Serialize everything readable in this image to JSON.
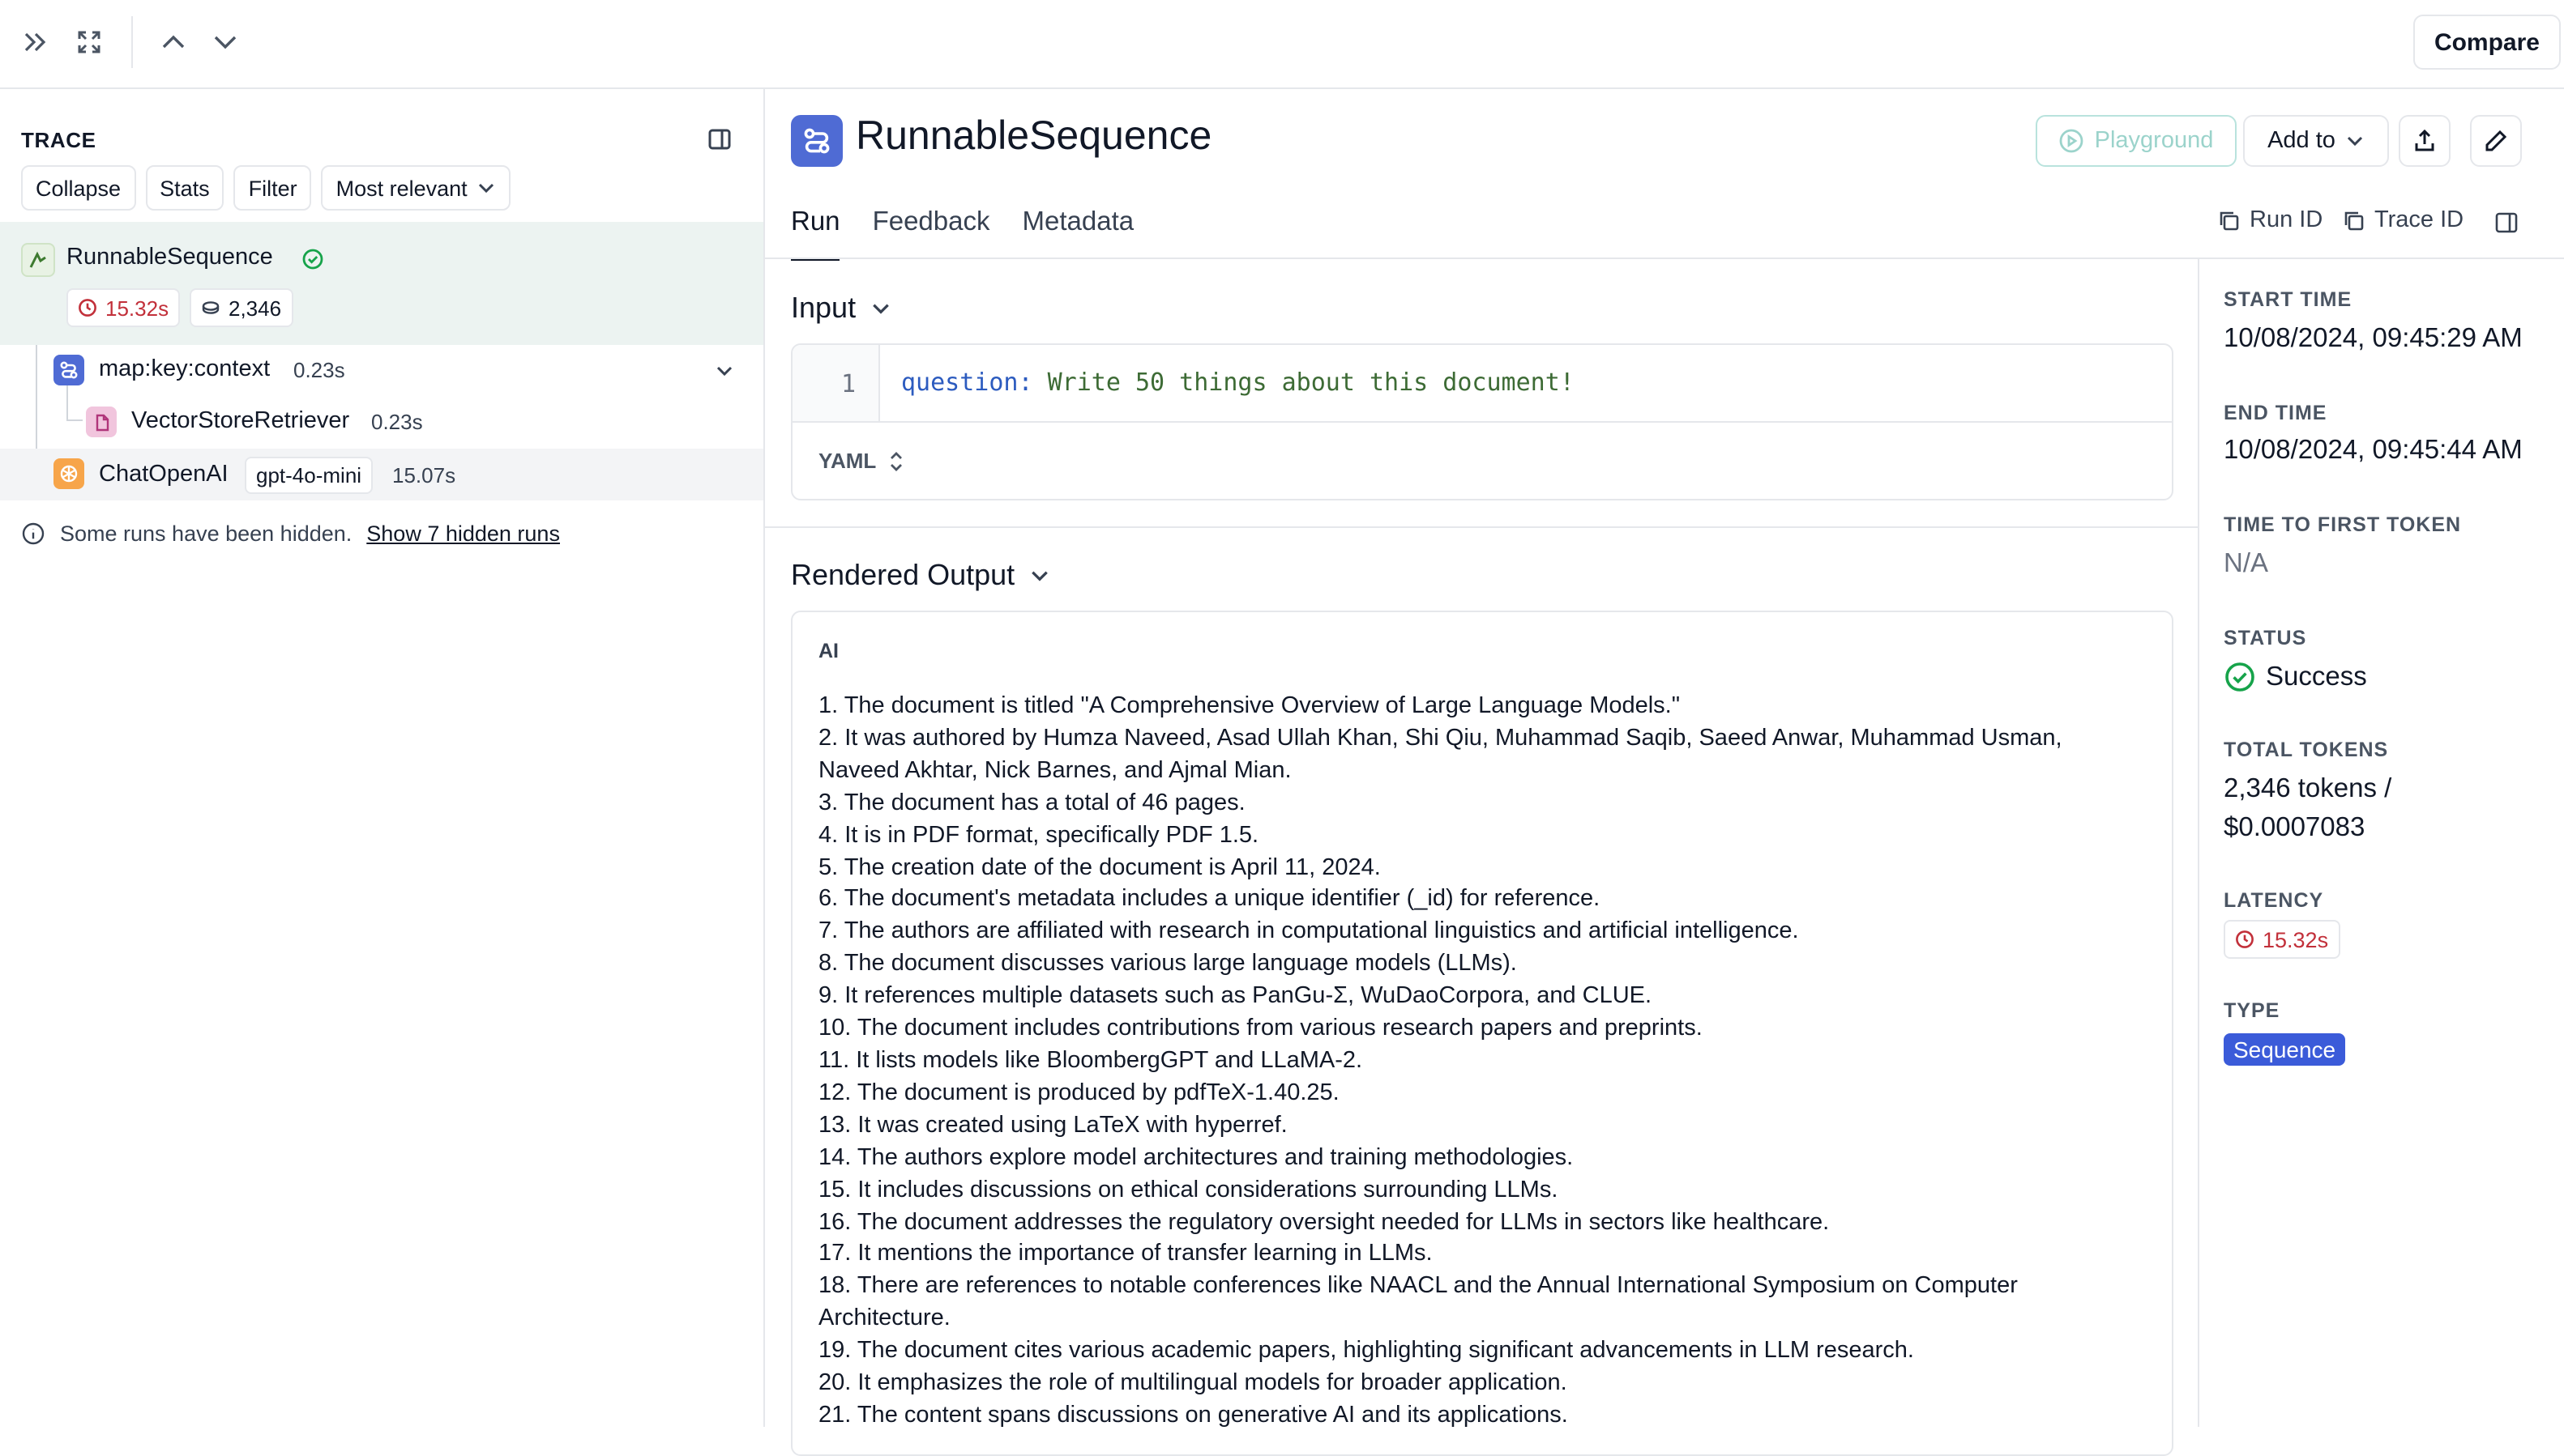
{
  "toolbar": {
    "compare_label": "Compare"
  },
  "trace": {
    "title": "TRACE",
    "chips": {
      "collapse": "Collapse",
      "stats": "Stats",
      "filter": "Filter",
      "sort": "Most relevant"
    },
    "root": {
      "name": "RunnableSequence",
      "latency": "15.32s",
      "tokens": "2,346"
    },
    "children": [
      {
        "name": "map:key:context",
        "time": "0.23s"
      },
      {
        "name": "VectorStoreRetriever",
        "time": "0.23s"
      },
      {
        "name": "ChatOpenAI",
        "model": "gpt-4o-mini",
        "time": "15.07s"
      }
    ],
    "hidden_note": "Some runs have been hidden.",
    "hidden_link": "Show 7 hidden runs"
  },
  "header": {
    "title": "RunnableSequence",
    "playground_label": "Playground",
    "add_to_label": "Add to"
  },
  "tabs": [
    {
      "label": "Run"
    },
    {
      "label": "Feedback"
    },
    {
      "label": "Metadata"
    }
  ],
  "tab_actions": {
    "run_id": "Run ID",
    "trace_id": "Trace ID"
  },
  "input": {
    "title": "Input",
    "line_number": "1",
    "key": "question:",
    "value": " Write 50 things about this document!",
    "format": "YAML"
  },
  "output": {
    "title": "Rendered Output",
    "role": "AI",
    "lines": [
      "1. The document is titled \"A Comprehensive Overview of Large Language Models.\"",
      "2. It was authored by Humza Naveed, Asad Ullah Khan, Shi Qiu, Muhammad Saqib, Saeed Anwar, Muhammad Usman, Naveed Akhtar, Nick Barnes, and Ajmal Mian.",
      "3. The document has a total of 46 pages.",
      "4. It is in PDF format, specifically PDF 1.5.",
      "5. The creation date of the document is April 11, 2024.",
      "6. The document's metadata includes a unique identifier (_id) for reference.",
      "7. The authors are affiliated with research in computational linguistics and artificial intelligence.",
      "8. The document discusses various large language models (LLMs).",
      "9. It references multiple datasets such as PanGu-Σ, WuDaoCorpora, and CLUE.",
      "10. The document includes contributions from various research papers and preprints.",
      "11. It lists models like BloombergGPT and LLaMA-2.",
      "12. The document is produced by pdfTeX-1.40.25.",
      "13. It was created using LaTeX with hyperref.",
      "14. The authors explore model architectures and training methodologies.",
      "15. It includes discussions on ethical considerations surrounding LLMs.",
      "16. The document addresses the regulatory oversight needed for LLMs in sectors like healthcare.",
      "17. It mentions the importance of transfer learning in LLMs.",
      "18. There are references to notable conferences like NAACL and the Annual International Symposium on Computer Architecture.",
      "19. The document cites various academic papers, highlighting significant advancements in LLM research.",
      "20. It emphasizes the role of multilingual models for broader application.",
      "21. The content spans discussions on generative AI and its applications."
    ]
  },
  "details": {
    "start_time": {
      "label": "START TIME",
      "value": "10/08/2024, 09:45:29 AM"
    },
    "end_time": {
      "label": "END TIME",
      "value": "10/08/2024, 09:45:44 AM"
    },
    "ttft": {
      "label": "TIME TO FIRST TOKEN",
      "value": "N/A"
    },
    "status": {
      "label": "STATUS",
      "value": "Success"
    },
    "total_tokens": {
      "label": "TOTAL TOKENS",
      "line1": "2,346 tokens /",
      "line2": "$0.0007083"
    },
    "latency": {
      "label": "LATENCY",
      "value": "15.32s"
    },
    "type": {
      "label": "TYPE",
      "value": "Sequence"
    }
  },
  "colors": {
    "accent": "#3b5bd9",
    "success": "#16a34a",
    "latency_red": "#c2303a",
    "selected_bg": "#ecf3f1"
  }
}
